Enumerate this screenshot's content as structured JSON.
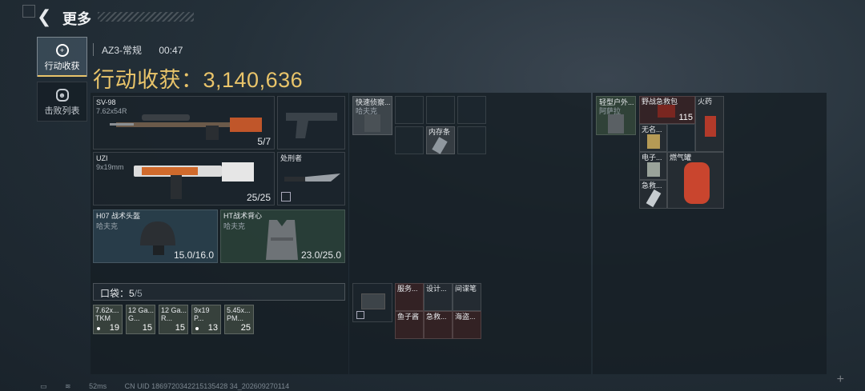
{
  "header": {
    "title": "更多"
  },
  "sidebar": {
    "tabs": [
      {
        "label": "行动收获"
      },
      {
        "label": "击败列表"
      }
    ]
  },
  "info": {
    "map": "AZ3-常规",
    "time": "00:47"
  },
  "harvest": {
    "label": "行动收获：3,140,636"
  },
  "weapons": {
    "primary": {
      "name": "SV-98",
      "caliber": "7.62x54R",
      "ammo": "5/7"
    },
    "secondary": {
      "name": "UZI",
      "caliber": "9x19mm",
      "ammo": "25/25"
    },
    "melee": {
      "name": "处刑者"
    }
  },
  "armor": {
    "helmet": {
      "name": "H07 战术头盔",
      "brand": "哈夫克",
      "durability": "15.0/16.0"
    },
    "vest": {
      "name": "HT战术背心",
      "brand": "哈夫克",
      "durability": "23.0/25.0"
    }
  },
  "pockets": {
    "label": "口袋：",
    "count": "5",
    "total": "/5",
    "items": [
      {
        "name": "7.62x...",
        "tag": "TKM",
        "count": "19",
        "dot": true
      },
      {
        "name": "12 Ga...",
        "tag": "G...",
        "count": "15",
        "dot": false
      },
      {
        "name": "12 Ga...",
        "tag": "R...",
        "count": "15",
        "dot": false
      },
      {
        "name": "9x19",
        "tag": "P...",
        "count": "13",
        "dot": true
      },
      {
        "name": "5.45x...",
        "tag": "PM...",
        "count": "25",
        "dot": false
      }
    ]
  },
  "chest_rig": {
    "name": "快速侦察...",
    "brand": "哈夫克",
    "item": "内存条"
  },
  "backpack": {
    "name": "轻型户外...",
    "brand": "阿萨拉",
    "items": {
      "medkit": {
        "name": "野战急救包",
        "count": "115"
      },
      "fire": {
        "name": "火药"
      },
      "unnamed": {
        "name": "无名..."
      },
      "electronics": {
        "name": "电子..."
      },
      "gas": {
        "name": "燃气罐"
      },
      "first_aid": {
        "name": "急救..."
      }
    }
  },
  "case": {
    "items": [
      {
        "name": "服务..."
      },
      {
        "name": "设计..."
      },
      {
        "name": "间谍笔"
      },
      {
        "name": "鱼子酱"
      },
      {
        "name": "急救..."
      },
      {
        "name": "海盗..."
      }
    ]
  },
  "status": {
    "ping": "52ms",
    "uid": "CN UID 1869720342215135428 34_202609270114"
  },
  "colors": {
    "accent": "#e9c46a",
    "panel": "#161e25"
  }
}
